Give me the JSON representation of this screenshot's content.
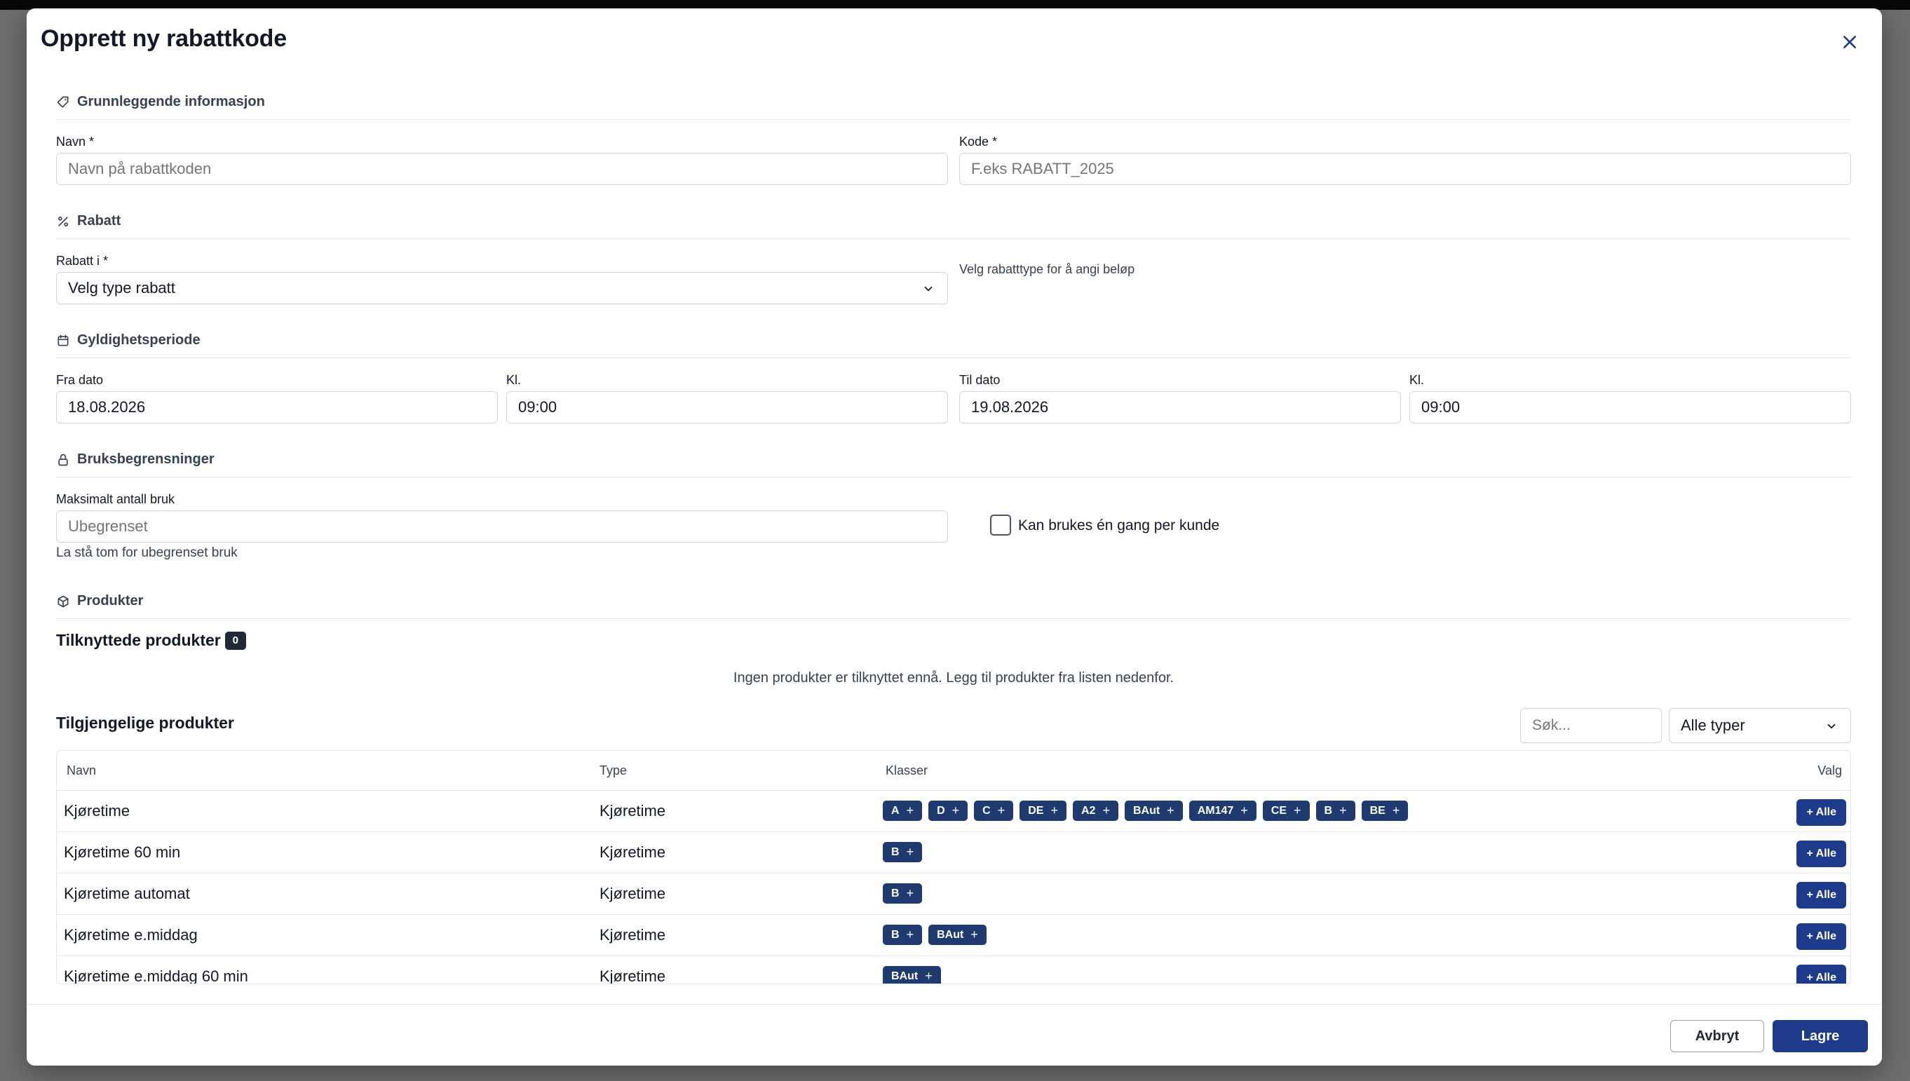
{
  "modal": {
    "title": "Opprett ny rabattkode",
    "close_icon": "close-icon"
  },
  "sections": {
    "basic": {
      "title": "Grunnleggende informasjon",
      "icon": "tag-icon"
    },
    "discount": {
      "title": "Rabatt",
      "icon": "percent-icon"
    },
    "validity": {
      "title": "Gyldighetsperiode",
      "icon": "calendar-icon"
    },
    "limits": {
      "title": "Bruksbegrensninger",
      "icon": "lock-icon"
    },
    "products": {
      "title": "Produkter",
      "icon": "box-icon"
    }
  },
  "fields": {
    "name": {
      "label": "Navn *",
      "placeholder": "Navn på rabattkoden"
    },
    "code": {
      "label": "Kode *",
      "placeholder": "F.eks RABATT_2025"
    },
    "discount_type": {
      "label": "Rabatt i *",
      "value": "Velg type rabatt",
      "hint": "Velg rabatttype for å angi beløp"
    },
    "from_date": {
      "label": "Fra dato",
      "value": "18.08.2026"
    },
    "from_time": {
      "label": "Kl.",
      "value": "09:00"
    },
    "to_date": {
      "label": "Til dato",
      "value": "19.08.2026"
    },
    "to_time": {
      "label": "Kl.",
      "value": "09:00"
    },
    "max_uses": {
      "label": "Maksimalt antall bruk",
      "placeholder": "Ubegrenset",
      "helper": "La stå tom for ubegrenset bruk"
    },
    "once_per_customer": {
      "label": "Kan brukes én gang per kunde",
      "checked": false
    }
  },
  "products": {
    "linked_title": "Tilknyttede produkter",
    "linked_count": "0",
    "empty_text": "Ingen produkter er tilknyttet ennå. Legg til produkter fra listen nedenfor.",
    "available_title": "Tilgjengelige produkter",
    "search_placeholder": "Søk...",
    "type_filter": "Alle typer",
    "columns": {
      "name": "Navn",
      "type": "Type",
      "classes": "Klasser",
      "action": "Valg"
    },
    "all_button": "+ Alle",
    "rows": [
      {
        "name": "Kjøretime",
        "type": "Kjøretime",
        "classes": [
          "A",
          "D",
          "C",
          "DE",
          "A2",
          "BAut",
          "AM147",
          "CE",
          "B",
          "BE"
        ]
      },
      {
        "name": "Kjøretime 60 min",
        "type": "Kjøretime",
        "classes": [
          "B"
        ]
      },
      {
        "name": "Kjøretime automat",
        "type": "Kjøretime",
        "classes": [
          "B"
        ]
      },
      {
        "name": "Kjøretime e.middag",
        "type": "Kjøretime",
        "classes": [
          "B",
          "BAut"
        ]
      },
      {
        "name": "Kjøretime e.middag 60 min",
        "type": "Kjøretime",
        "classes": [
          "BAut"
        ]
      }
    ]
  },
  "footer": {
    "cancel_label": "Avbryt",
    "save_label": "Lagre"
  },
  "colors": {
    "primary": "#1e3a8a",
    "chip": "#1e3a6e",
    "border": "#d1d5db"
  }
}
